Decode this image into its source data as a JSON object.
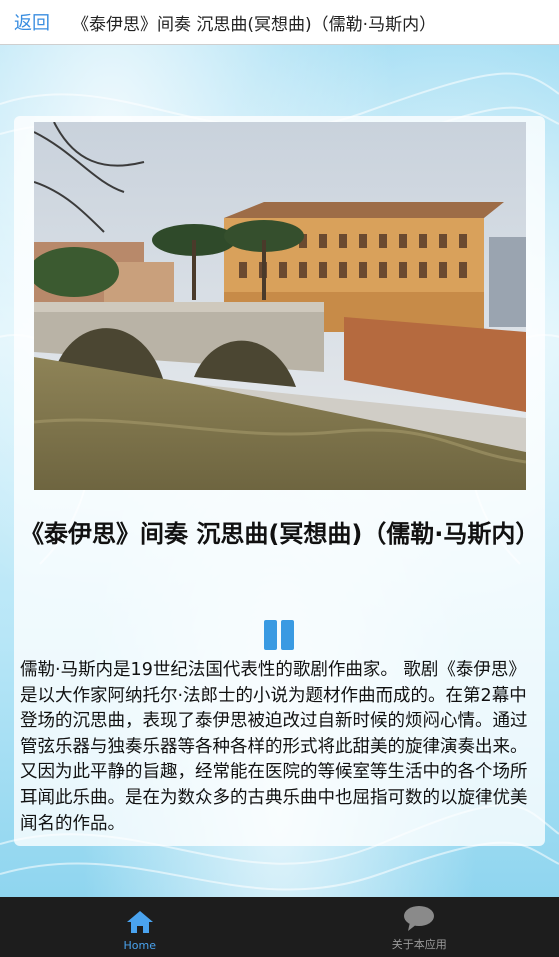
{
  "header": {
    "back_label": "返回",
    "title": "《泰伊思》间奏 沉思曲(冥想曲)（儒勒·马斯内）"
  },
  "main": {
    "image_name": "photo",
    "title": "《泰伊思》间奏 沉思曲(冥想曲)（儒勒·马斯内）",
    "description": "儒勒·马斯内是19世纪法国代表性的歌剧作曲家。 歌剧《泰伊思》是以大作家阿纳托尔·法郎士的小说为题材作曲而成的。在第2幕中登场的沉思曲，表现了泰伊思被迫改过自新时候的烦闷心情。通过管弦乐器与独奏乐器等各种各样的形式将此甜美的旋律演奏出来。又因为此平静的旨趣，经常能在医院的等候室等生活中的各个场所耳闻此乐曲。是在为数众多的古典乐曲中也屈指可数的以旋律优美闻名的作品。",
    "player_icon": "pause-icon"
  },
  "tabbar": {
    "tabs": [
      {
        "label": "Home",
        "icon": "home-icon",
        "active": true
      },
      {
        "label": "关于本应用",
        "icon": "chat-bubble-icon",
        "active": false
      }
    ]
  },
  "colors": {
    "accent": "#3a9ae2",
    "tab_active": "#4aa3ee",
    "tabbar_bg": "#1d1d1d"
  }
}
